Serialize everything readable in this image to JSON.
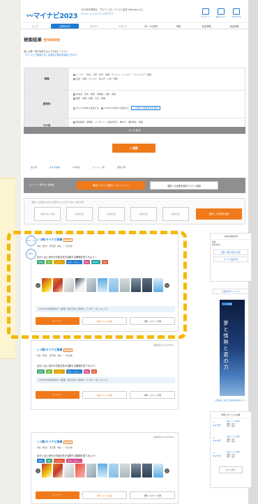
{
  "header": {
    "logo": "マイナビ2023",
    "info_line1": "2023年卒業見込 「ログイン中」マイナビ会員 (Member)さん",
    "info_line2": "マイページ | ヘルプ | ログアウト",
    "icons": [
      {
        "label": "マイページ",
        "icon": "mail-icon"
      },
      {
        "label": "検討リスト",
        "icon": "bookmark-icon"
      },
      {
        "label": "Members",
        "icon": "building-icon"
      }
    ]
  },
  "nav": [
    "トップ",
    "企業を探す",
    "セミナー",
    "イベント",
    "OB・OG訪問",
    "特集",
    "就活準備",
    "就活情報"
  ],
  "results": {
    "title": "検索結果",
    "count": "全9999社"
  },
  "notice": {
    "line1": "既に企業・条件を絞り込んでお探しください",
    "link1": "「マイナビで検索する」企業名や条件を指定できます"
  },
  "filter": {
    "rows": [
      {
        "label": "業種",
        "lines": [
          "メーカー　商社　小売・外食　金融　サービス・インフラ　ソフトウエア・通信",
          "広告・出版・マスコミ　官公庁・公社・団体"
        ]
      },
      {
        "label": "勤務地",
        "lines": [
          "北海道　東北　関東　甲信越・北陸　東海",
          "関西　中国・四国　九州・沖縄"
        ]
      },
      {
        "label": "その他",
        "lines": [
          "選考情報　説明会　インターン　社員を知る　働き方　福利厚生　制度"
        ]
      }
    ],
    "radio_all": "すべての条件に該当する",
    "radio_any": "いずれかの条件に該当する",
    "reset": "この条件で検索条件を保存"
  },
  "more_options": "もっと見る",
  "search_button": "検索",
  "sort": {
    "label": "並び順",
    "options": [
      "おすすめ順",
      "50音順",
      "エントリー数",
      "更新日順"
    ]
  },
  "bar": {
    "tabs": "エントリー受付中 | 説明会",
    "btn1": "検討リストに追加してエントリー",
    "btn2": "選択した企業を検討リストに追加"
  },
  "compare": {
    "caption": "選択した企業をまとめて比較することができます（最大5社）",
    "slot1": "企業を選んで比較",
    "slot2": "企業を選ぶ",
    "slot3": "企業を選ぶ",
    "slot4": "企業を選ぶ",
    "slot5": "企業を選ぶ",
    "button": "選択した企業を比較"
  },
  "cards": [
    {
      "badge": "社員インタビュー",
      "badge2": "動画あり",
      "company": "(株)マイナビ商事",
      "tag": "PR情報",
      "meta": "商社（総合）　東京都　本社　（一部上場）",
      "date": "最終更新日 2022/04/01",
      "catch": "自分と近い世代の先輩社員が活躍する職場を見てみよう！",
      "tags": [
        "説明会",
        "選考",
        "インターン",
        "社員インタビュー",
        "動画",
        "福利厚生",
        "研修"
      ],
      "info": "【2023年3月卒業者向け】  説明会・選考日程のご案内をしています！ 詳しくはこちら",
      "btn_entry": "エントリー",
      "btn_list": "検討リストに追加",
      "btn_detail": "詳細・ログイン登録"
    },
    {
      "company": "(株)マイナビ商事",
      "tag": "PR情報",
      "meta": "商社（総合）　東京都　本社　（一部上場）",
      "date": "最終更新日 2022/04/01",
      "catch": "自分と近い世代の先輩社員が活躍する職場を見てみよう！",
      "tags": [
        "説明会",
        "選考",
        "インターン",
        "社員インタビュー",
        "動画",
        "研修"
      ],
      "info": "【2023年3月卒業者向け】  説明会・選考日程のご案内をしています！ 詳しくはこちら",
      "btn_entry": "エントリー",
      "btn_list": "検討リストに追加",
      "btn_detail": "詳細・ログイン登録"
    },
    {
      "company": "(株)マイナビ商事",
      "tag": "PR情報",
      "meta": "商社（総合）　東京都　本社　（一部上場）",
      "date": "最終更新日 2022/04/01",
      "catch": "自分と近い世代の先輩社員が活躍する職場を見てみよう！",
      "tags": [
        "説明会",
        "選考",
        "インターン",
        "社員インタビュー"
      ],
      "btn_entry": "エントリー",
      "btn_list": "検討リストに追加",
      "btn_detail": "詳細・ログイン登録"
    }
  ],
  "right": {
    "box1_title": "今週の検索条件",
    "box1_text": "業種\n商社(総合)",
    "box1_link1": "業種・地域で探す(中部)",
    "box1_link2": "マイナビ検索条件",
    "link_all": "全検索条件ランキング",
    "banner_label": "マイナビ就職",
    "banner_text": "夢と情熱と君の力",
    "banner_caption": "企業研究に役立つ業界研究動画セミナー",
    "rec_title": "閲覧されている企業",
    "rec": [
      {
        "name": "(株)マイナビ商事",
        "l2": "業種　商社",
        "l3": "本社　東京"
      },
      {
        "name": "(株)マイナビ商事",
        "l2": "業種　商社",
        "l3": "本社　東京"
      },
      {
        "name": "(株)マイナビ商事",
        "l2": "業種　商社",
        "l3": "本社　東京"
      }
    ],
    "rec_logo": "マイナビ",
    "more": "もっと見る"
  },
  "colors": {
    "accent": "#f07a1a",
    "brand": "#1e7bd0",
    "highlight": "#f5b800"
  }
}
